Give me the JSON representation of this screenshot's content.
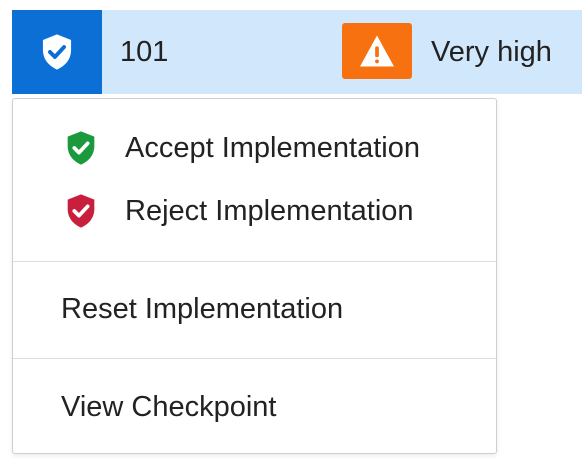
{
  "row": {
    "id": "101",
    "risk_label": "Very high",
    "shield_icon": "shield-check-icon",
    "risk_icon": "warning-triangle-icon",
    "colors": {
      "row_background": "#d0e7fc",
      "shield_background": "#0b6fd6",
      "risk_badge": "#f77110"
    }
  },
  "menu": {
    "items": [
      {
        "label": "Accept Implementation",
        "icon": "shield-check-icon",
        "icon_color": "#1a9a3c"
      },
      {
        "label": "Reject Implementation",
        "icon": "shield-check-icon",
        "icon_color": "#c8203c"
      },
      {
        "label": "Reset Implementation"
      },
      {
        "label": "View Checkpoint"
      }
    ]
  }
}
